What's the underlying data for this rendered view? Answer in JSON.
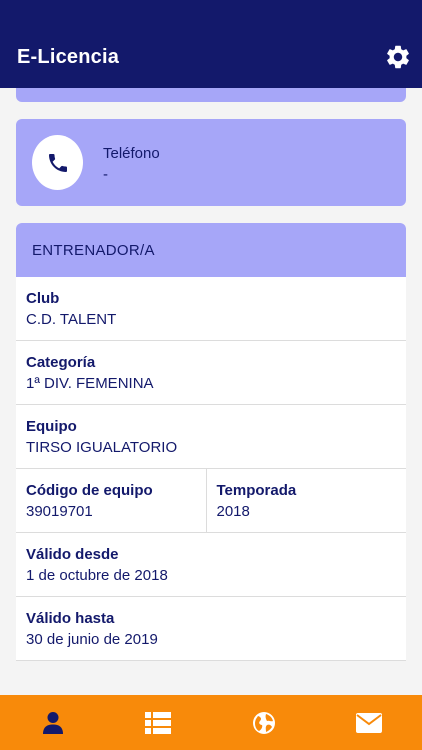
{
  "header": {
    "title": "E-Licencia",
    "settings_icon": "gear-icon"
  },
  "contact": {
    "phone_label": "Teléfono",
    "phone_value": "-",
    "icon": "phone-icon"
  },
  "section": {
    "title": "ENTRENADOR/A",
    "rows": [
      {
        "label": "Club",
        "value": "C.D. TALENT"
      },
      {
        "label": "Categoría",
        "value": "1ª DIV. FEMENINA"
      },
      {
        "label": "Equipo",
        "value": "TIRSO IGUALATORIO"
      },
      {
        "cells": [
          {
            "label": "Código de equipo",
            "value": "39019701"
          },
          {
            "label": "Temporada",
            "value": "2018"
          }
        ]
      },
      {
        "label": "Válido desde",
        "value": "1 de octubre de 2018"
      },
      {
        "label": "Válido hasta",
        "value": "30 de junio de 2019"
      }
    ]
  },
  "bottom_nav": {
    "items": [
      {
        "icon": "user-icon",
        "active": true
      },
      {
        "icon": "list-icon"
      },
      {
        "icon": "globe-icon"
      },
      {
        "icon": "mail-icon"
      }
    ]
  },
  "colors": {
    "primary": "#13196b",
    "card": "#a6a6f8",
    "accent": "#f88a0a"
  }
}
